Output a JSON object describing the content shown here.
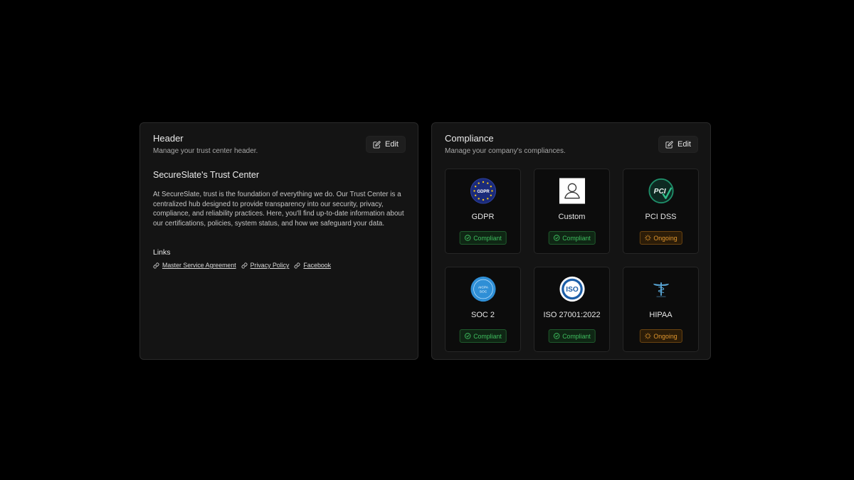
{
  "header_card": {
    "title": "Header",
    "subtitle": "Manage your trust center header.",
    "edit_label": "Edit",
    "trust_center_title": "SecureSlate's Trust Center",
    "description": "At SecureSlate, trust is the foundation of everything we do. Our Trust Center is a centralized hub designed to provide transparency into our security, privacy, compliance, and reliability practices. Here, you'll find up-to-date information about our certifications, policies, system status, and how we safeguard your data.",
    "links_label": "Links",
    "links": [
      {
        "label": "Master Service Agreement",
        "icon": "link-icon"
      },
      {
        "label": "Privacy Policy",
        "icon": "link-icon"
      },
      {
        "label": "Facebook",
        "icon": "link-icon"
      }
    ]
  },
  "compliance_card": {
    "title": "Compliance",
    "subtitle": "Manage your company's compliances.",
    "edit_label": "Edit",
    "items": [
      {
        "name": "GDPR",
        "status": "Compliant",
        "logo": "gdpr-logo",
        "logo_text": "GDPR"
      },
      {
        "name": "Custom",
        "status": "Compliant",
        "logo": "user-placeholder-icon"
      },
      {
        "name": "PCI DSS",
        "status": "Ongoing",
        "logo": "pci-logo",
        "logo_text": "PCI"
      },
      {
        "name": "SOC 2",
        "status": "Compliant",
        "logo": "aicpa-soc-logo",
        "logo_text": "AICPA SOC"
      },
      {
        "name": "ISO 27001:2022",
        "status": "Compliant",
        "logo": "iso-logo",
        "logo_text": "ISO"
      },
      {
        "name": "HIPAA",
        "status": "Ongoing",
        "logo": "hipaa-logo"
      }
    ]
  },
  "colors": {
    "page_background": "#000000",
    "card_background": "#141414",
    "compliant_green": "#3fbf5f",
    "ongoing_orange": "#e0962e"
  }
}
